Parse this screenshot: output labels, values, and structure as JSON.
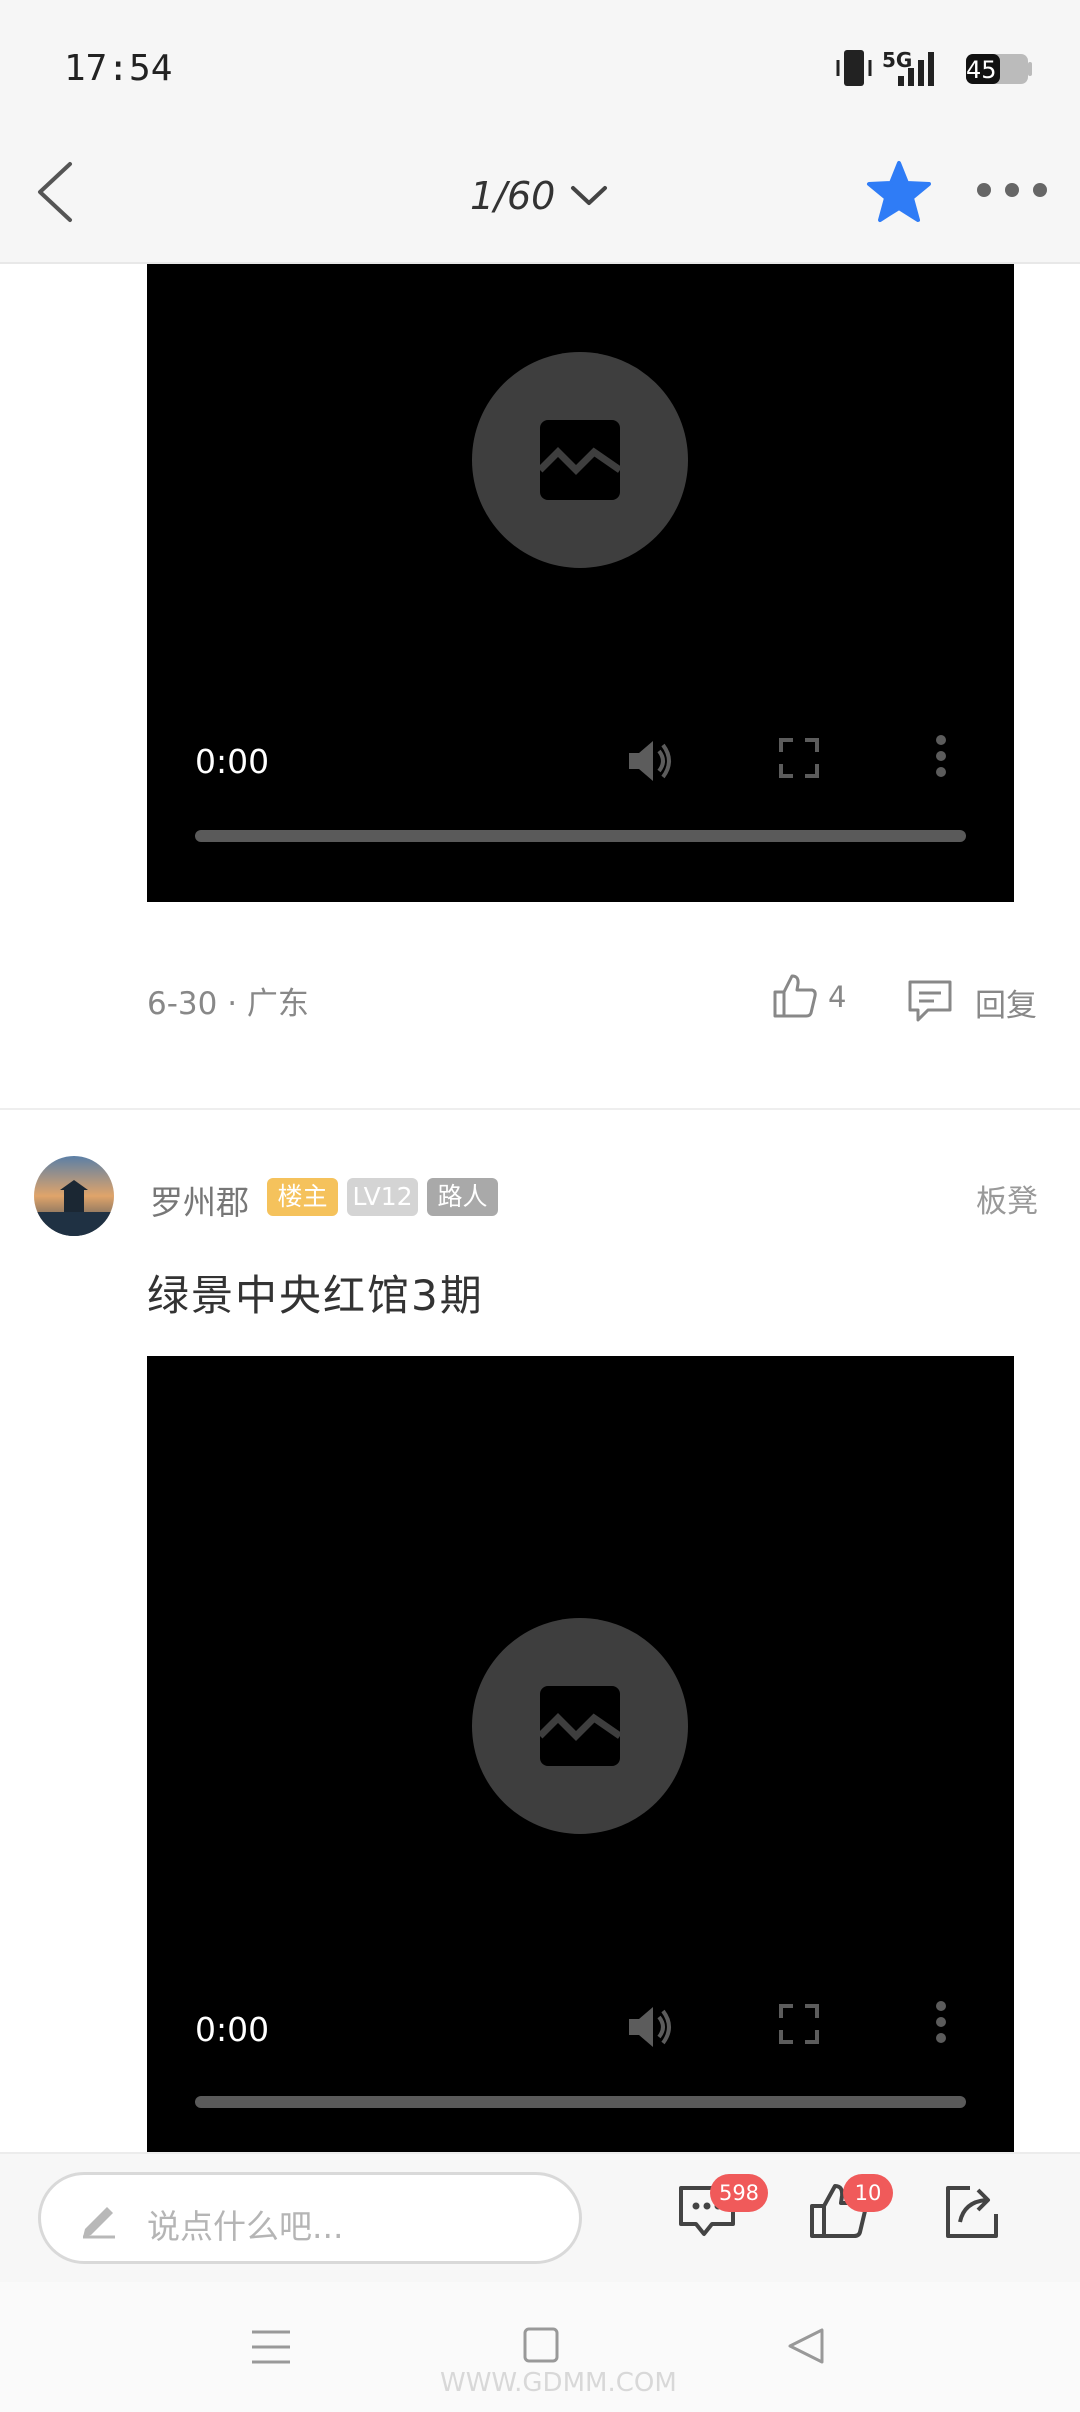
{
  "status_bar": {
    "time": "17:54",
    "network": "5G",
    "battery": "45"
  },
  "nav": {
    "page_indicator": "1/60"
  },
  "videos": [
    {
      "time": "0:00"
    },
    {
      "time": "0:00"
    }
  ],
  "post_meta": {
    "date_location": "6-30 · 广东",
    "like_count": "4",
    "reply_label": "回复"
  },
  "comment": {
    "username": "罗州郡",
    "badge_owner": "楼主",
    "badge_level": "LV12",
    "badge_role": "路人",
    "floor": "板凳",
    "text": "绿景中央红馆3期"
  },
  "bottom_bar": {
    "input_placeholder": "说点什么吧...",
    "comment_count": "598",
    "like_count": "10"
  },
  "watermark": "WWW.GDMM.COM",
  "colors": {
    "accent_blue": "#2f7cf6",
    "badge_owner": "#f5c25c",
    "count_badge": "#f05a5a",
    "video_bg": "#000000"
  }
}
